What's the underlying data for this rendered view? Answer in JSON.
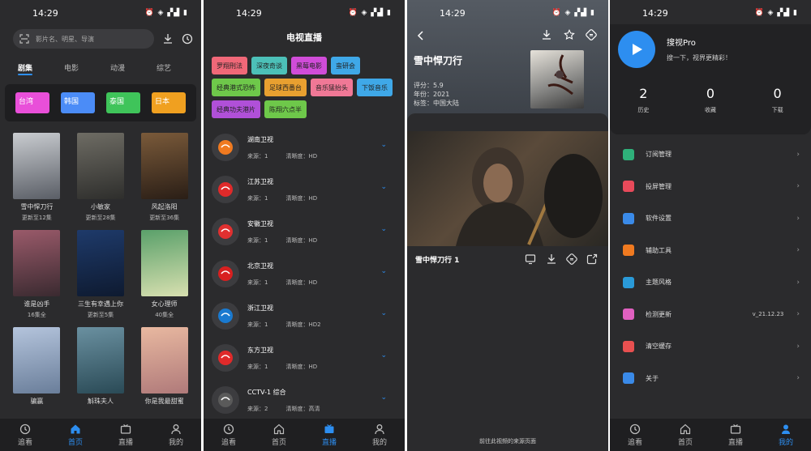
{
  "status": {
    "time": "14:29",
    "icons": "⏰ ◈ ▞▟ ▮"
  },
  "home": {
    "search_placeholder": "影片名、明星、导演",
    "tabs": [
      {
        "label": "剧集"
      },
      {
        "label": "电影"
      },
      {
        "label": "动漫"
      },
      {
        "label": "综艺"
      }
    ],
    "regions": [
      {
        "label": "台湾",
        "color": "#e94fd9"
      },
      {
        "label": "韩国",
        "color": "#4b8cf7"
      },
      {
        "label": "泰国",
        "color": "#3fc45a"
      },
      {
        "label": "日本",
        "color": "#f0a020"
      }
    ],
    "cards": [
      {
        "title": "雪中悍刀行",
        "sub": "更新至12集",
        "c1": "#c9ccd0",
        "c2": "#5a5e66"
      },
      {
        "title": "小敏家",
        "sub": "更新至28集",
        "c1": "#6e6c64",
        "c2": "#2e2e2c"
      },
      {
        "title": "风起洛阳",
        "sub": "更新至36集",
        "c1": "#7a5a3a",
        "c2": "#2a1e16"
      },
      {
        "title": "谁是凶手",
        "sub": "16集全",
        "c1": "#9a5a6a",
        "c2": "#3a2a30"
      },
      {
        "title": "三生有幸遇上你",
        "sub": "更新至5集",
        "c1": "#1e3a6a",
        "c2": "#0e1a30"
      },
      {
        "title": "女心理师",
        "sub": "40集全",
        "c1": "#5aa06a",
        "c2": "#d8e0b0"
      },
      {
        "title": "骗赢",
        "sub": "",
        "c1": "#b4c4dc",
        "c2": "#6a7e9a"
      },
      {
        "title": "斛珠夫人",
        "sub": "",
        "c1": "#6a90a0",
        "c2": "#2a4a56"
      },
      {
        "title": "你是我最甜蜜",
        "sub": "",
        "c1": "#e8b8a0",
        "c2": "#b07a7a"
      }
    ]
  },
  "nav": {
    "items": [
      {
        "label": "追看"
      },
      {
        "label": "首页"
      },
      {
        "label": "直播"
      },
      {
        "label": "我的"
      }
    ]
  },
  "live": {
    "title": "电视直播",
    "chips": [
      {
        "label": "罗翔刑法",
        "color": "#f06878"
      },
      {
        "label": "深夜奇谈",
        "color": "#4cc0b8"
      },
      {
        "label": "黑莓电影",
        "color": "#d04cd8"
      },
      {
        "label": "蛮研会",
        "color": "#3fa8e8"
      },
      {
        "label": "经典港式恐怖",
        "color": "#6ec84a"
      },
      {
        "label": "足球西番台",
        "color": "#e8a030"
      },
      {
        "label": "音乐猛抬头",
        "color": "#f07896"
      },
      {
        "label": "下饭音乐",
        "color": "#3fa8e8"
      },
      {
        "label": "经典功夫港片",
        "color": "#b050d8"
      },
      {
        "label": "陈翔六点半",
        "color": "#6ec84a"
      }
    ],
    "channels": [
      {
        "name": "湖南卫视",
        "source": "来源：1",
        "quality": "清晰度：HD",
        "color": "#f07a20"
      },
      {
        "name": "江苏卫视",
        "source": "来源：1",
        "quality": "清晰度：HD",
        "color": "#e02a2a"
      },
      {
        "name": "安徽卫视",
        "source": "来源：1",
        "quality": "清晰度：HD",
        "color": "#e03030"
      },
      {
        "name": "北京卫视",
        "source": "来源：1",
        "quality": "清晰度：HD",
        "color": "#d82020"
      },
      {
        "name": "浙江卫视",
        "source": "来源：1",
        "quality": "清晰度：HD2",
        "color": "#1a7ad0"
      },
      {
        "name": "东方卫视",
        "source": "来源：1",
        "quality": "清晰度：HD",
        "color": "#e02a2a"
      },
      {
        "name": "CCTV-1 综合",
        "source": "来源：2",
        "quality": "清晰度：高清",
        "color": "#5a5a5a"
      }
    ]
  },
  "detail": {
    "title": "雪中悍刀行",
    "rating": "评分：5.9",
    "year": "年份：2021",
    "area": "标签：中国大陆",
    "episode": "雪中悍刀行 1",
    "footer": "前往此视频的来源页面"
  },
  "profile": {
    "app_name": "搜视Pro",
    "slogan": "搜一下，视界更精彩！",
    "stats": [
      {
        "value": "2",
        "label": "历史"
      },
      {
        "value": "0",
        "label": "收藏"
      },
      {
        "value": "0",
        "label": "下载"
      }
    ],
    "menu": [
      {
        "label": "订阅管理",
        "value": "",
        "color": "#2fb07a"
      },
      {
        "label": "投屏管理",
        "value": "",
        "color": "#e84a5a"
      },
      {
        "label": "软件设置",
        "value": "",
        "color": "#3a8ae8"
      },
      {
        "label": "辅助工具",
        "value": "",
        "color": "#f07a20"
      },
      {
        "label": "主题风格",
        "value": "",
        "color": "#2a9ad8"
      },
      {
        "label": "检测更新",
        "value": "v_21.12.23",
        "color": "#e060c0"
      },
      {
        "label": "清空缓存",
        "value": "",
        "color": "#e85050"
      },
      {
        "label": "关于",
        "value": "",
        "color": "#3a8ae8"
      }
    ]
  }
}
